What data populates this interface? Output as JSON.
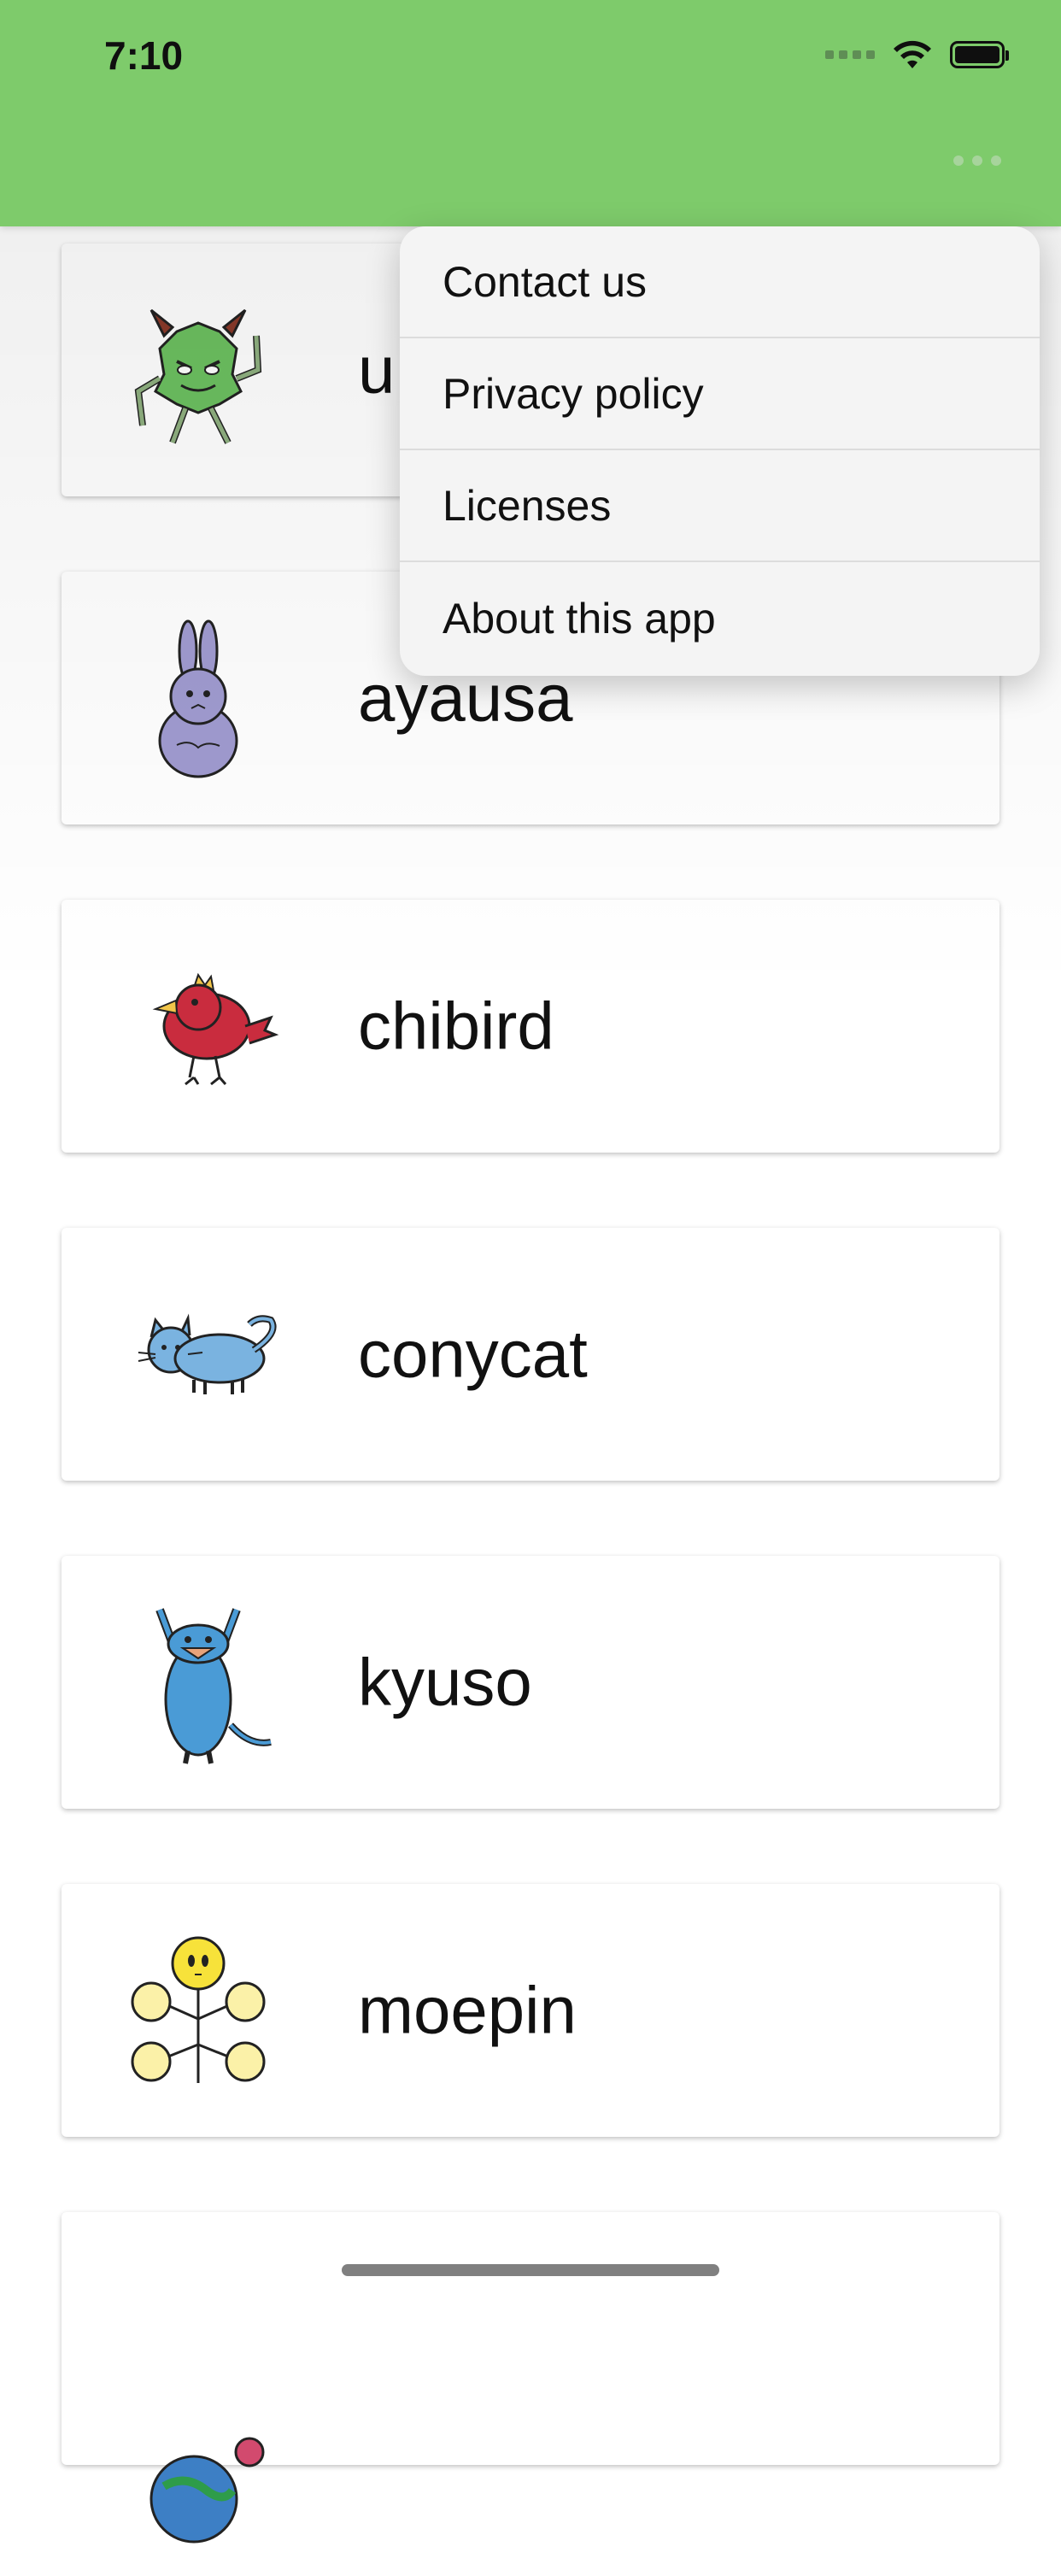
{
  "status_bar": {
    "time": "7:10"
  },
  "header": {
    "menu_icon": "more-horizontal-icon",
    "accent_color": "#7ecb6b"
  },
  "menu": {
    "items": [
      {
        "label": "Contact us"
      },
      {
        "label": "Privacy policy"
      },
      {
        "label": "Licenses"
      },
      {
        "label": "About this app"
      }
    ]
  },
  "characters": [
    {
      "name": "u",
      "icon": "green-monster-icon"
    },
    {
      "name": "ayausa",
      "icon": "purple-rabbit-icon"
    },
    {
      "name": "chibird",
      "icon": "red-bird-icon"
    },
    {
      "name": "conycat",
      "icon": "blue-cat-icon"
    },
    {
      "name": "kyuso",
      "icon": "blue-rodent-icon"
    },
    {
      "name": "moepin",
      "icon": "yellow-flower-icon"
    },
    {
      "name": "",
      "icon": "blue-globe-icon"
    }
  ]
}
